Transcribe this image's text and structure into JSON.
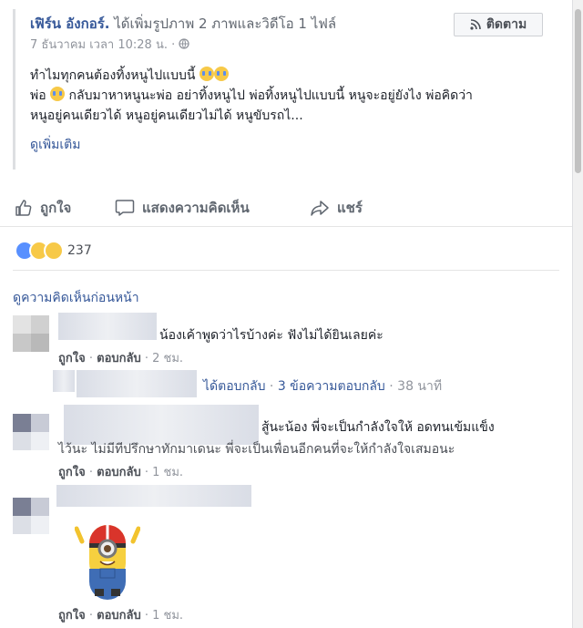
{
  "post": {
    "author": "เฟิร์น อังกอร์.",
    "action": "ได้เพิ่มรูปภาพ 2 ภาพและวิดีโอ 1 ไฟล์",
    "timestamp": "7 ธันวาคม เวลา 10:28 น.",
    "separator": "·",
    "follow_label": "ติดตาม",
    "line1": "ทำไมทุกคนต้องทิ้งหนูไปแบบนี้",
    "line2_a": "พ่อ",
    "line2_b": "กลับมาหาหนูนะพ่อ อย่าทิ้งหนูไป พ่อทิ้งหนูไปแบบนี้ หนูจะอยู่ยังไง พ่อคิดว่า",
    "line3": "หนูอยู่คนเดียวได้ หนูอยู่คนเดียวไม่ได้ หนูขับรถไ...",
    "see_more": "ดูเพิ่มเติม"
  },
  "actions": {
    "like": "ถูกใจ",
    "comment": "แสดงความคิดเห็น",
    "share": "แชร์"
  },
  "reactions": {
    "count": "237"
  },
  "comments_section": {
    "previous": "ดูความคิดเห็นก่อนหน้า"
  },
  "comments": [
    {
      "text": "น้องเค้าพูดว่าไรบ้างค่ะ ฟังไม่ได้ยินเลยค่ะ",
      "like": "ถูกใจ",
      "reply": "ตอบกลับ",
      "time": "2 ชม."
    },
    {
      "reply_text": "ได้ตอบกลับ",
      "replies": "3 ข้อความตอบกลับ",
      "time": "38 นาที"
    },
    {
      "text_a": "สู้นะน้อง พี่จะเป็นกำลังใจให้ อดทนเข้มแข็ง",
      "text_b": "ไว้นะ ไม่มีทีปรึกษาทักมาเดนะ พี่จะเป็นเพื่อนอีกคนที่จะให้กำลังใจเสมอนะ",
      "like": "ถูกใจ",
      "reply": "ตอบกลับ",
      "time": "1 ชม."
    },
    {
      "like": "ถูกใจ",
      "reply": "ตอบกลับ",
      "time": "1 ชม."
    }
  ],
  "colors": {
    "link": "#365899",
    "muted": "#90949c",
    "like_blue": "#5890ff"
  },
  "icons": [
    "rss-icon",
    "globe-icon",
    "thumbs-up-icon",
    "comment-icon",
    "share-icon",
    "crying-emoji",
    "minion-sticker"
  ]
}
